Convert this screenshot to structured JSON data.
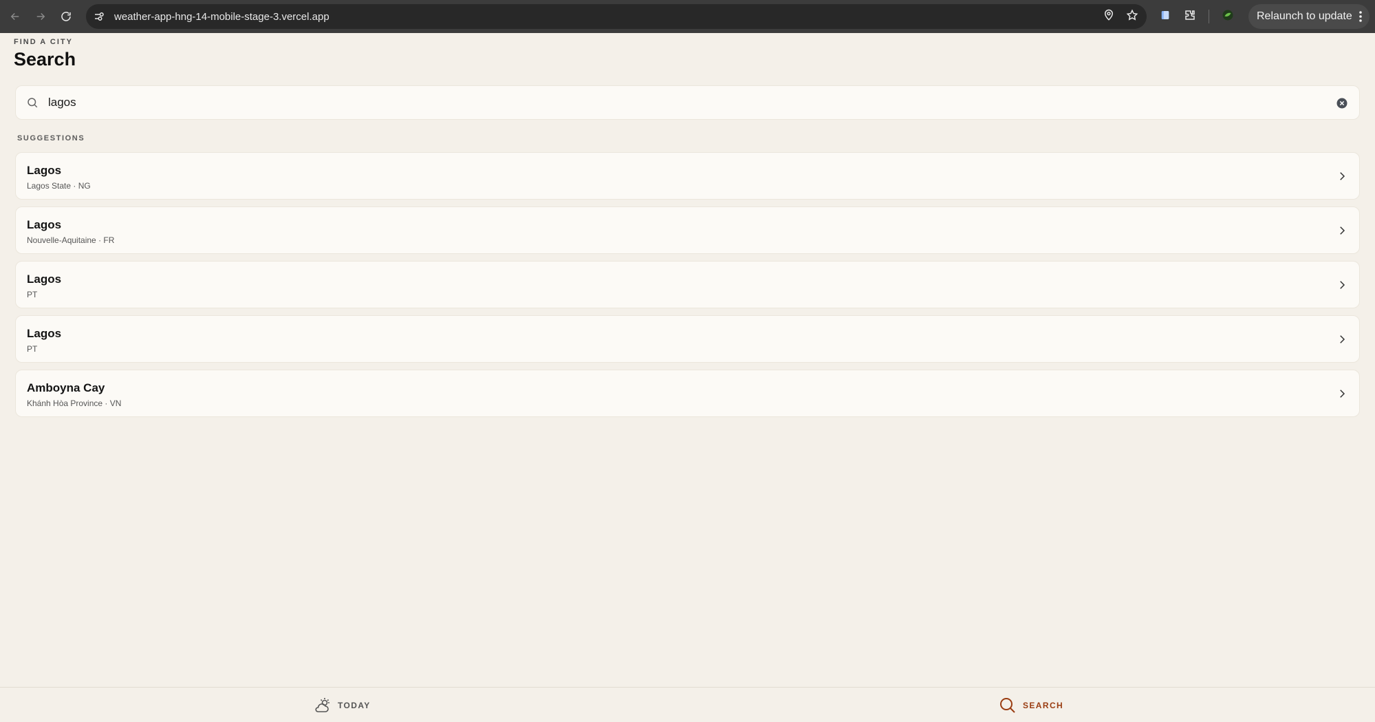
{
  "browser": {
    "url": "weather-app-hng-14-mobile-stage-3.vercel.app",
    "relaunch_label": "Relaunch to update"
  },
  "header": {
    "eyebrow": "FIND A CITY",
    "title": "Search"
  },
  "search": {
    "value": "lagos"
  },
  "suggestions": {
    "label": "SUGGESTIONS",
    "items": [
      {
        "name": "Lagos",
        "region": "Lagos State · NG"
      },
      {
        "name": "Lagos",
        "region": "Nouvelle-Aquitaine · FR"
      },
      {
        "name": "Lagos",
        "region": "PT"
      },
      {
        "name": "Lagos",
        "region": "PT"
      },
      {
        "name": "Amboyna Cay",
        "region": "Khánh Hòa Province · VN"
      }
    ]
  },
  "bottom_nav": {
    "today_label": "TODAY",
    "search_label": "SEARCH"
  },
  "colors": {
    "background": "#f4f0e9",
    "active_tab": "#9a3d12",
    "card": "#fcfaf6"
  }
}
